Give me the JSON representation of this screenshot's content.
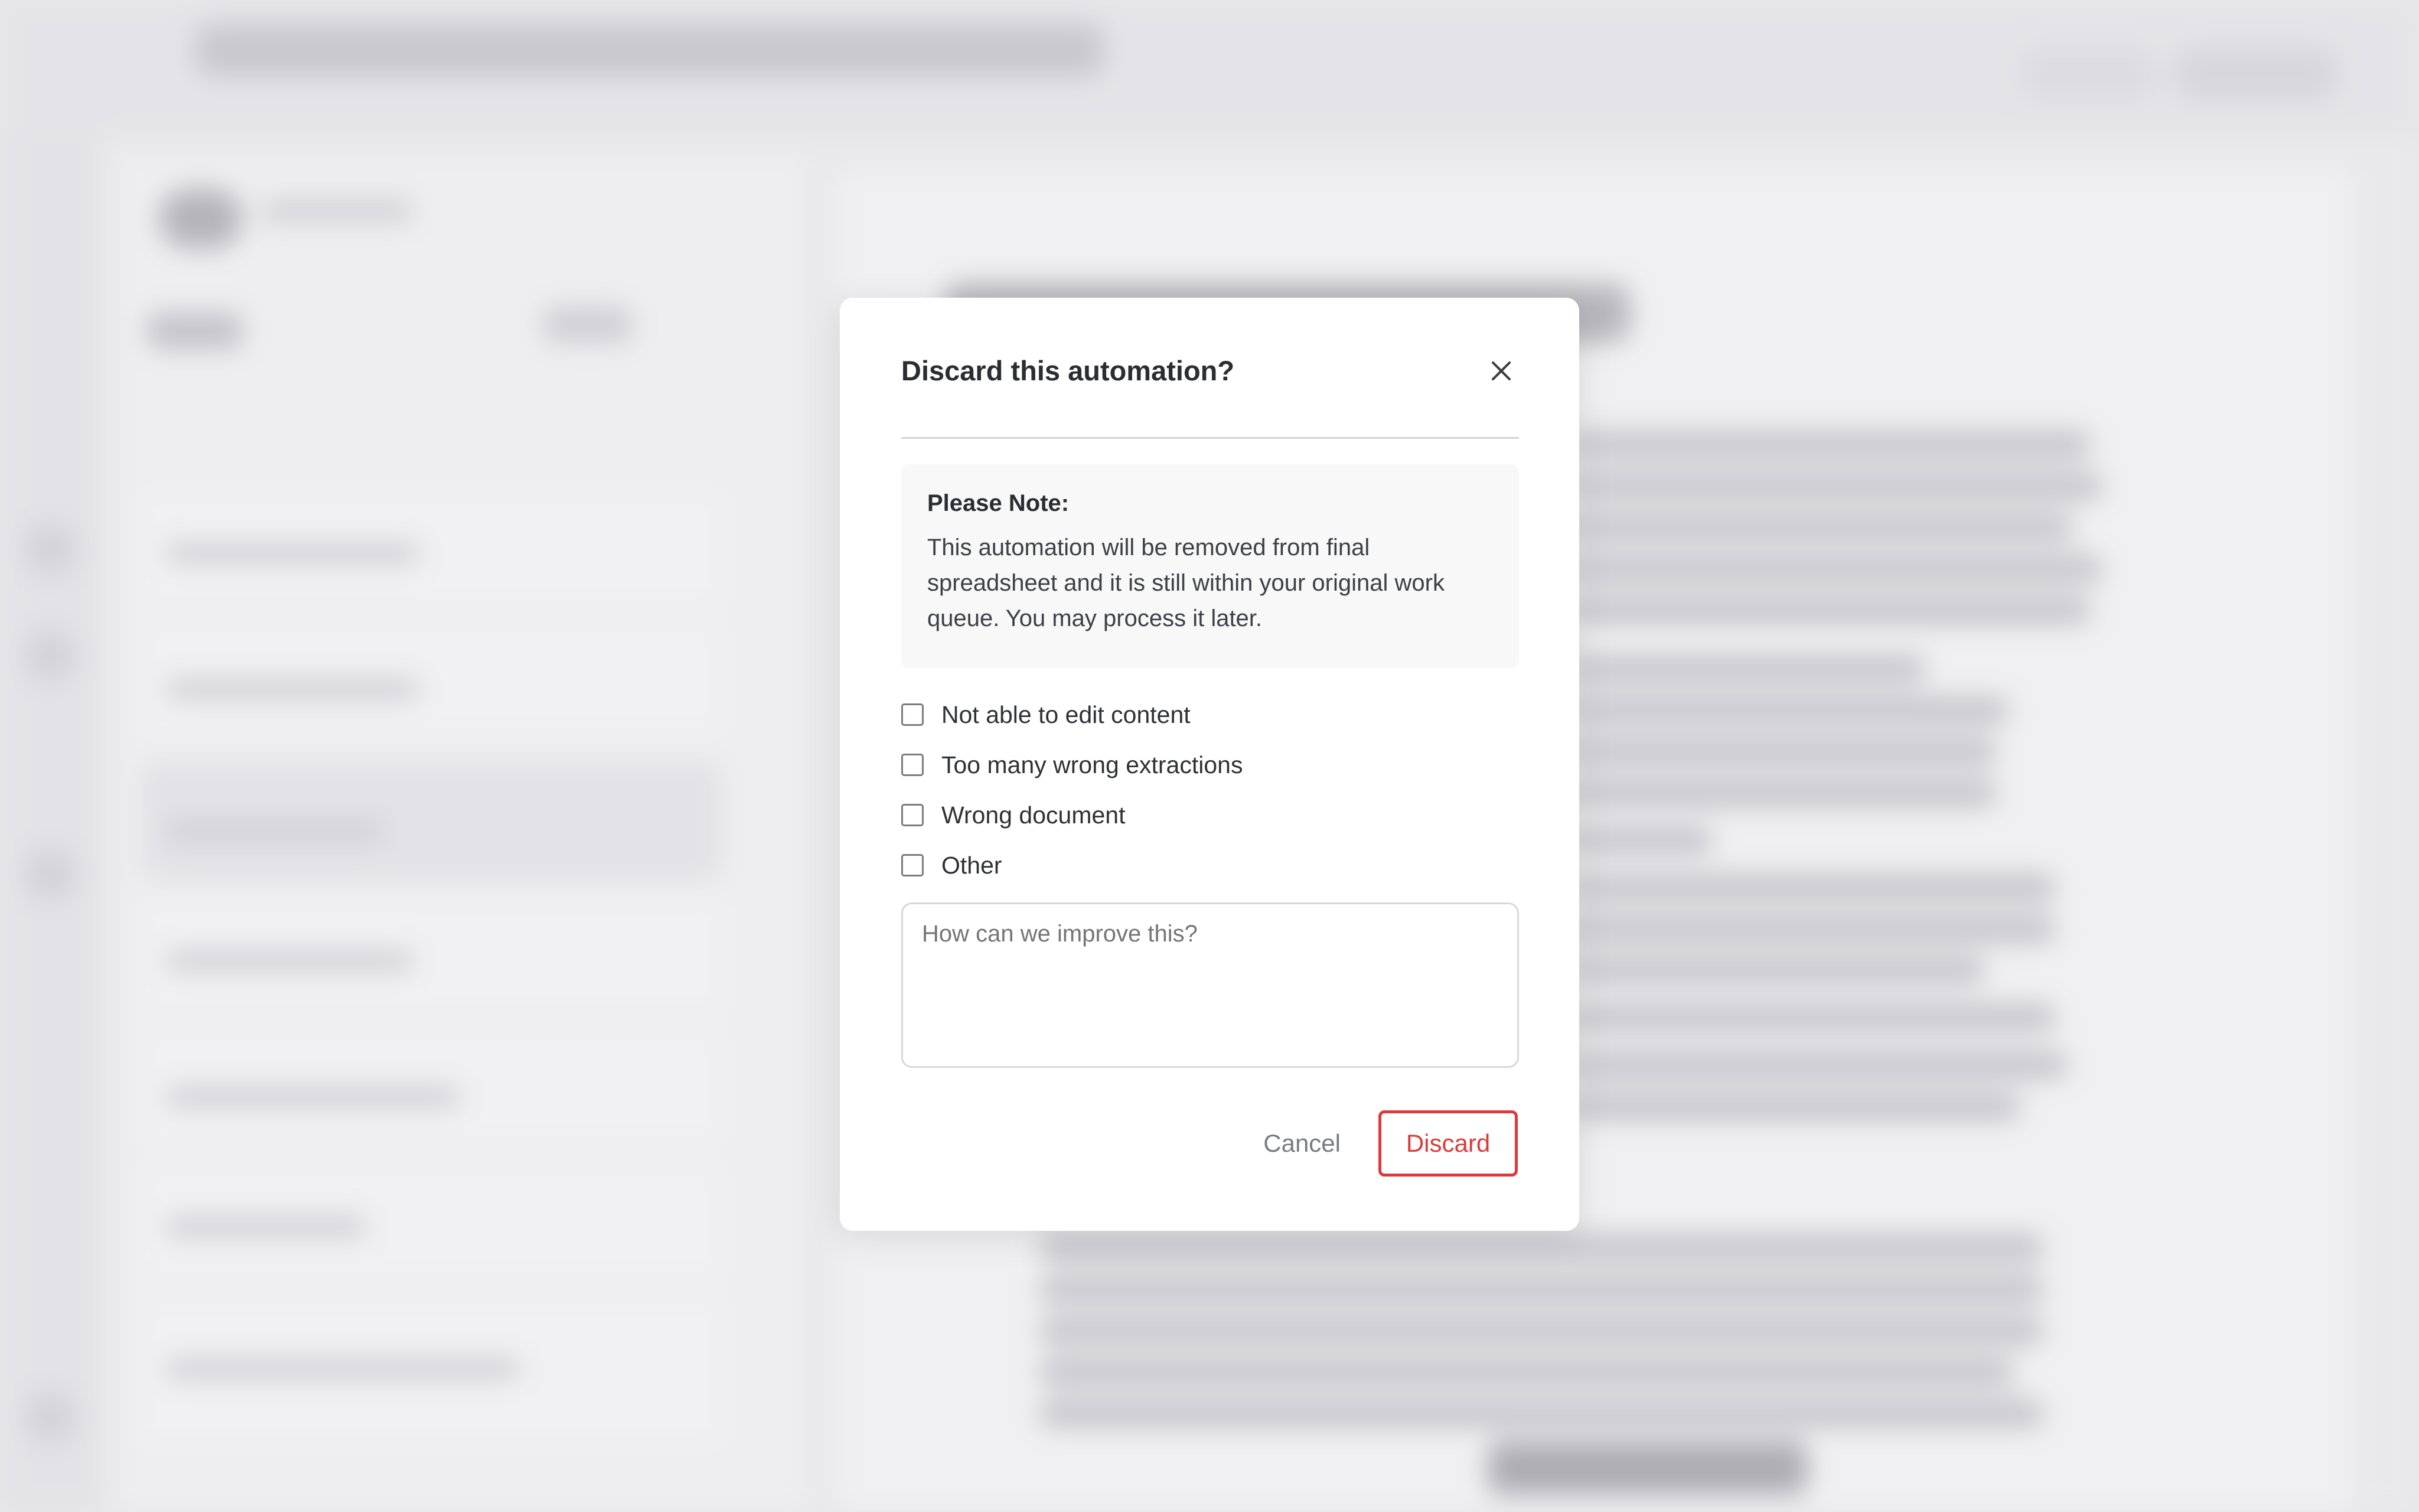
{
  "dialog": {
    "title": "Discard this automation?",
    "close_icon": "close-icon",
    "note": {
      "heading": "Please Note:",
      "body": "This automation will be removed from final spreadsheet and it is still within your original work queue. You may process it later."
    },
    "reasons": [
      {
        "label": "Not able to edit content",
        "checked": false
      },
      {
        "label": "Too many wrong extractions",
        "checked": false
      },
      {
        "label": "Wrong document",
        "checked": false
      },
      {
        "label": "Other",
        "checked": false
      }
    ],
    "feedback": {
      "placeholder": "How can we improve this?",
      "value": ""
    },
    "buttons": {
      "cancel_label": "Cancel",
      "discard_label": "Discard"
    }
  },
  "colors": {
    "danger": "#dc3b3b",
    "scrim": "#e9e9ec",
    "modal_bg": "#ffffff"
  }
}
